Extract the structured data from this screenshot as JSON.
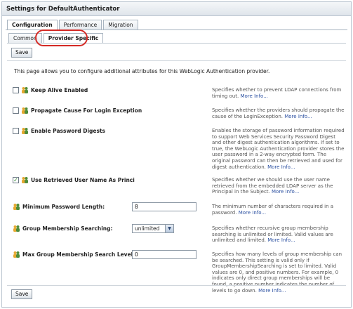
{
  "window": {
    "title": "Settings for DefaultAuthenticator"
  },
  "tabs_primary": [
    "Configuration",
    "Performance",
    "Migration"
  ],
  "tabs_secondary": [
    "Common",
    "Provider Specific"
  ],
  "buttons": {
    "save_top": "Save",
    "save_bottom": "Save"
  },
  "intro": "This page allows you to configure additional attributes for this WebLogic Authentication provider.",
  "more_info": "More Info...",
  "settings": [
    {
      "label": "Keep Alive Enabled",
      "checked": false,
      "desc": "Specifies whether to prevent LDAP connections from timing out."
    },
    {
      "label": "Propagate Cause For Login Exception",
      "checked": false,
      "desc": "Specifies whether the providers should propagate the cause of the LoginException."
    },
    {
      "label": "Enable Password Digests",
      "checked": false,
      "desc": "Enables the storage of password information required to support Web Services Security Password Digest and other digest authentication algorithms. If set to true, the WebLogic Authentication provider stores the user password in a 2-way encrypted form. The original password can then be retrieved and used for digest authentication."
    },
    {
      "label": "Use Retrieved User Name As Principal",
      "checked": true,
      "desc": "Specifies whether we should use the user name retrieved from the embedded LDAP server as the Principal in the Subject."
    },
    {
      "label": "Minimum Password Length:",
      "value": "8",
      "desc": "The minimum number of characters required in a password."
    },
    {
      "label": "Group Membership Searching:",
      "value": "unlimited",
      "desc": "Specifies whether recursive group membership searching is unlimited or limited. Valid values are unlimited and limited."
    },
    {
      "label": "Max Group Membership Search Level:",
      "value": "0",
      "desc": "Specifies how many levels of group membership can be searched. This setting is valid only if GroupMembershipSearching is set to limited. Valid values are 0, and positive numbers. For example, 0 indicates only direct group memberships will be found, a positive number indicates the number of levels to go down."
    }
  ],
  "colors": {
    "highlight": "#d42a25",
    "link": "#2a4fa0",
    "checked": "#2a8a2a"
  }
}
